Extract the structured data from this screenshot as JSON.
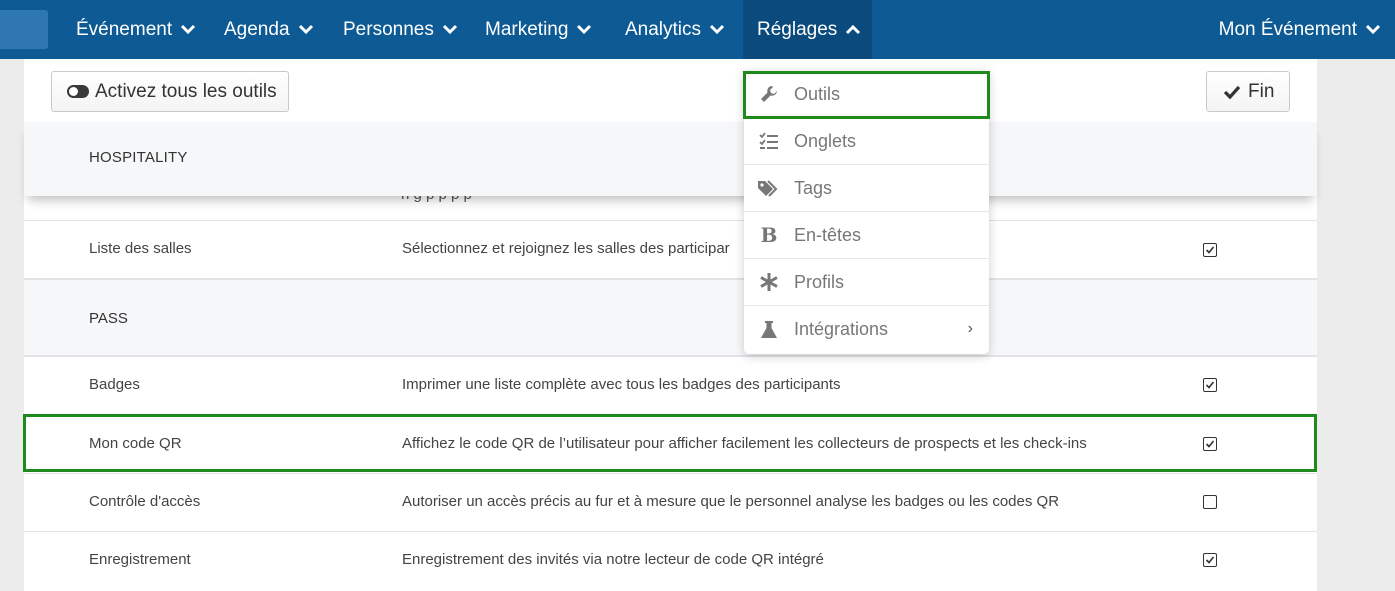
{
  "nav": {
    "items": [
      {
        "label": "Événement"
      },
      {
        "label": "Agenda"
      },
      {
        "label": "Personnes"
      },
      {
        "label": "Marketing"
      },
      {
        "label": "Analytics"
      },
      {
        "label": "Réglages"
      }
    ],
    "right_label": "Mon Événement",
    "active_item": "Réglages"
  },
  "toolbar": {
    "activate_label": "Activez tous les outils",
    "done_label": "Fin"
  },
  "sticky_section": {
    "label": "HOSPITALITY"
  },
  "rows_top": [
    {
      "name": "Liste des salles",
      "description": "Sélectionnez et rejoignez les salles des participar",
      "checked": true
    }
  ],
  "section_pass": {
    "label": "PASS"
  },
  "rows": [
    {
      "name": "Badges",
      "description": "Imprimer une liste complète avec tous les badges des participants",
      "checked": true
    },
    {
      "name": "Mon code QR",
      "description": "Affichez le code QR de l’utilisateur pour afficher facilement les collecteurs de prospects et les check-ins",
      "checked": true
    },
    {
      "name": "Contrôle d'accès",
      "description": "Autoriser un accès précis au fur et à mesure que le personnel analyse les badges ou les codes QR",
      "checked": false
    },
    {
      "name": "Enregistrement",
      "description": "Enregistrement des invités via notre lecteur de code QR intégré",
      "checked": true
    }
  ],
  "dropdown": {
    "items": [
      {
        "label": "Outils",
        "icon": "wrench-icon"
      },
      {
        "label": "Onglets",
        "icon": "checklist-icon"
      },
      {
        "label": "Tags",
        "icon": "tags-icon"
      },
      {
        "label": "En-têtes",
        "icon": "bold-icon"
      },
      {
        "label": "Profils",
        "icon": "asterisk-icon"
      },
      {
        "label": "Intégrations",
        "icon": "flask-icon",
        "has_submenu": true
      }
    ]
  },
  "colors": {
    "nav_bg": "#0d5a94",
    "nav_active_bg": "#0a4a7d",
    "highlight_border": "#1e8a1e",
    "section_bg": "#f6f7f9"
  }
}
